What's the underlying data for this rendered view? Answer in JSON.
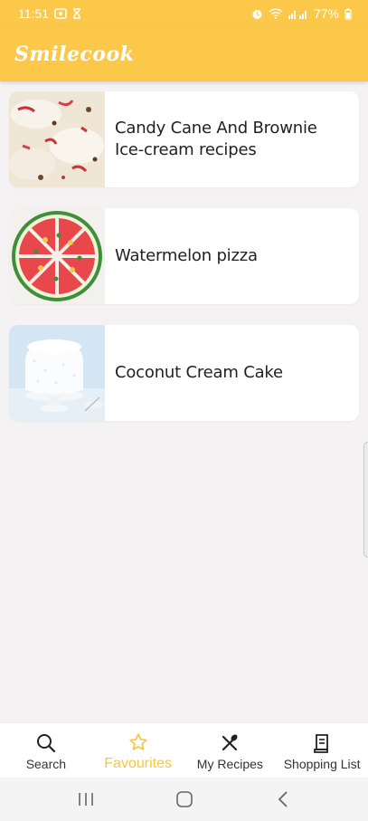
{
  "status_bar": {
    "time": "11:51",
    "battery": "77%",
    "left_icons": [
      "screenshot-icon",
      "hourglass-icon"
    ],
    "right_icons": [
      "alarm-icon",
      "wifi-icon",
      "signal-icon",
      "battery-icon"
    ]
  },
  "app_bar": {
    "title": "Smilecook"
  },
  "recipes": [
    {
      "title": "Candy Cane And Brownie Ice-cream recipes",
      "image": "candy-cane-brownie-image"
    },
    {
      "title": "Watermelon pizza",
      "image": "watermelon-pizza-image"
    },
    {
      "title": "Coconut Cream Cake",
      "image": "coconut-cake-image"
    }
  ],
  "bottom_nav": {
    "items": [
      {
        "label": "Search",
        "icon": "search-icon"
      },
      {
        "label": "Favourites",
        "icon": "star-icon",
        "active": true
      },
      {
        "label": "My Recipes",
        "icon": "utensils-icon"
      },
      {
        "label": "Shopping List",
        "icon": "receipt-icon"
      }
    ]
  },
  "colors": {
    "accent": "#fcc84a",
    "active_tab": "#f7c63f",
    "background": "#f4f2f2",
    "card": "#ffffff"
  }
}
